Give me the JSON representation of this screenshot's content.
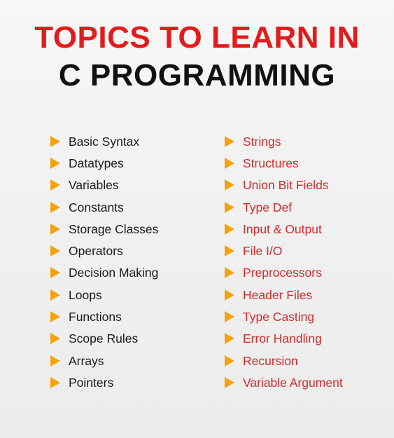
{
  "header": {
    "line1": "TOPICS TO LEARN IN",
    "line2": "C PROGRAMMING"
  },
  "colors": {
    "title_accent": "#e31b1b",
    "title_dark": "#111111",
    "bullet": "#f5a30a",
    "right_column_text": "#d42a2a",
    "left_column_text": "#1a1a1a"
  },
  "icons": {
    "bullet": "play-triangle-icon"
  },
  "left_topics": [
    "Basic Syntax",
    "Datatypes",
    "Variables",
    "Constants",
    "Storage Classes",
    "Operators",
    "Decision Making",
    "Loops",
    "Functions",
    "Scope Rules",
    "Arrays",
    "Pointers"
  ],
  "right_topics": [
    "Strings",
    "Structures",
    "Union Bit Fields",
    "Type Def",
    "Input & Output",
    "File I/O",
    "Preprocessors",
    "Header Files",
    "Type Casting",
    "Error Handling",
    "Recursion",
    "Variable Argument"
  ]
}
